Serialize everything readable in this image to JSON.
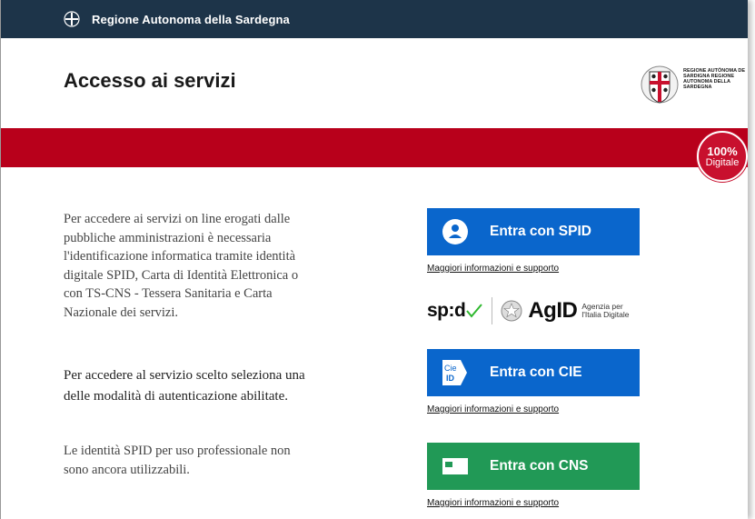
{
  "topbar": {
    "title": "Regione Autonoma della Sardegna"
  },
  "header": {
    "title": "Accesso ai servizi",
    "logo_text": "REGIONE AUTÒNOMA DE SARDIGNA REGIONE AUTONOMA DELLA SARDEGNA"
  },
  "badge": {
    "percent": "100%",
    "label": "Digitale"
  },
  "info": {
    "p1": "Per accedere ai servizi on line erogati dalle pubbliche amministrazioni è necessaria l'identificazione informatica tramite identità digitale SPID, Carta di Identità Elettronica o con TS-CNS - Tessera Sanitaria e Carta Nazionale dei servizi.",
    "p2": "Per accedere al servizio scelto seleziona una delle modalità di autenticazione abilitate.",
    "p3": "Le identità SPID per uso professionale non sono ancora utilizzabili."
  },
  "buttons": {
    "spid": {
      "label": "Entra con SPID",
      "help": "Maggiori informazioni e supporto",
      "color": "#0a66cc"
    },
    "cie": {
      "label": "Entra con CIE",
      "help": "Maggiori informazioni e supporto",
      "icon_text": "Cie ID",
      "color": "#0a66cc"
    },
    "cns": {
      "label": "Entra con CNS",
      "help": "Maggiori informazioni e supporto",
      "color": "#219956"
    }
  },
  "spid_logos": {
    "spid_word": "sp:d",
    "agid_word": "AgID",
    "agid_sub": "Agenzia per l'Italia Digitale"
  },
  "colors": {
    "topbar": "#1d3449",
    "red_band": "#b8001b"
  }
}
